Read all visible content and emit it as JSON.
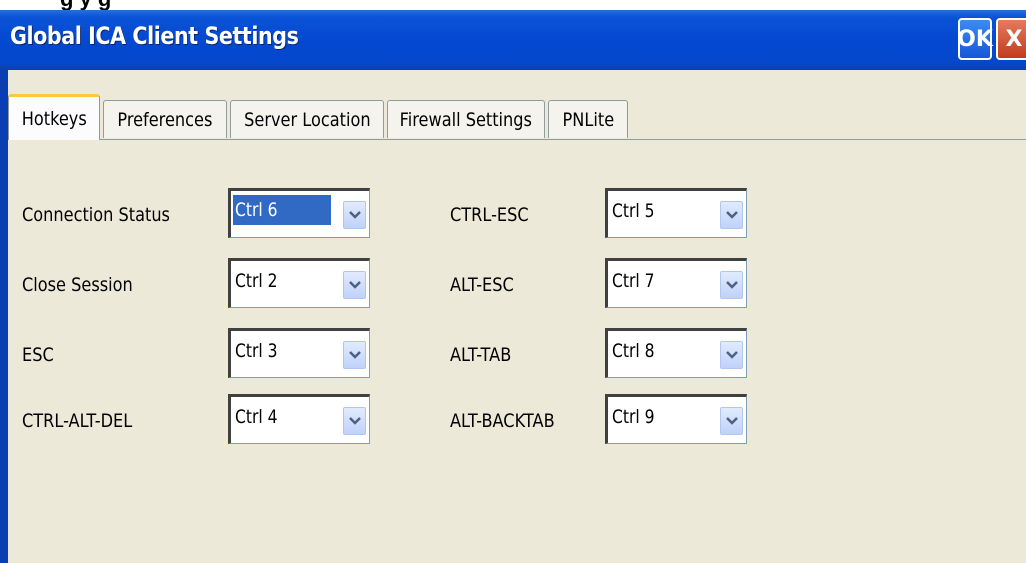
{
  "window": {
    "heading_fragment": "g      y      g",
    "title": "Global ICA Client Settings",
    "ok_label": "OK",
    "close_label": "X"
  },
  "tabs": [
    {
      "label": "Hotkeys",
      "active": true
    },
    {
      "label": "Preferences",
      "active": false
    },
    {
      "label": "Server Location",
      "active": false
    },
    {
      "label": "Firewall Settings",
      "active": false
    },
    {
      "label": "PNLite",
      "active": false
    }
  ],
  "hotkeys": {
    "left": [
      {
        "label": "Connection Status",
        "value": "Ctrl 6",
        "selected": true
      },
      {
        "label": "Close Session",
        "value": "Ctrl 2"
      },
      {
        "label": "ESC",
        "value": "Ctrl 3"
      },
      {
        "label": "CTRL-ALT-DEL",
        "value": "Ctrl 4"
      }
    ],
    "right": [
      {
        "label": "CTRL-ESC",
        "value": "Ctrl 5"
      },
      {
        "label": "ALT-ESC",
        "value": "Ctrl 7"
      },
      {
        "label": "ALT-TAB",
        "value": "Ctrl 8"
      },
      {
        "label": "ALT-BACKTAB",
        "value": "Ctrl 9"
      }
    ]
  },
  "icons": {
    "dropdown": "chevron-down-icon"
  },
  "colors": {
    "titlebar": "#0349d1",
    "selection": "#316ac5",
    "tab_highlight": "#ffc83c",
    "panel": "#ece9d8"
  }
}
